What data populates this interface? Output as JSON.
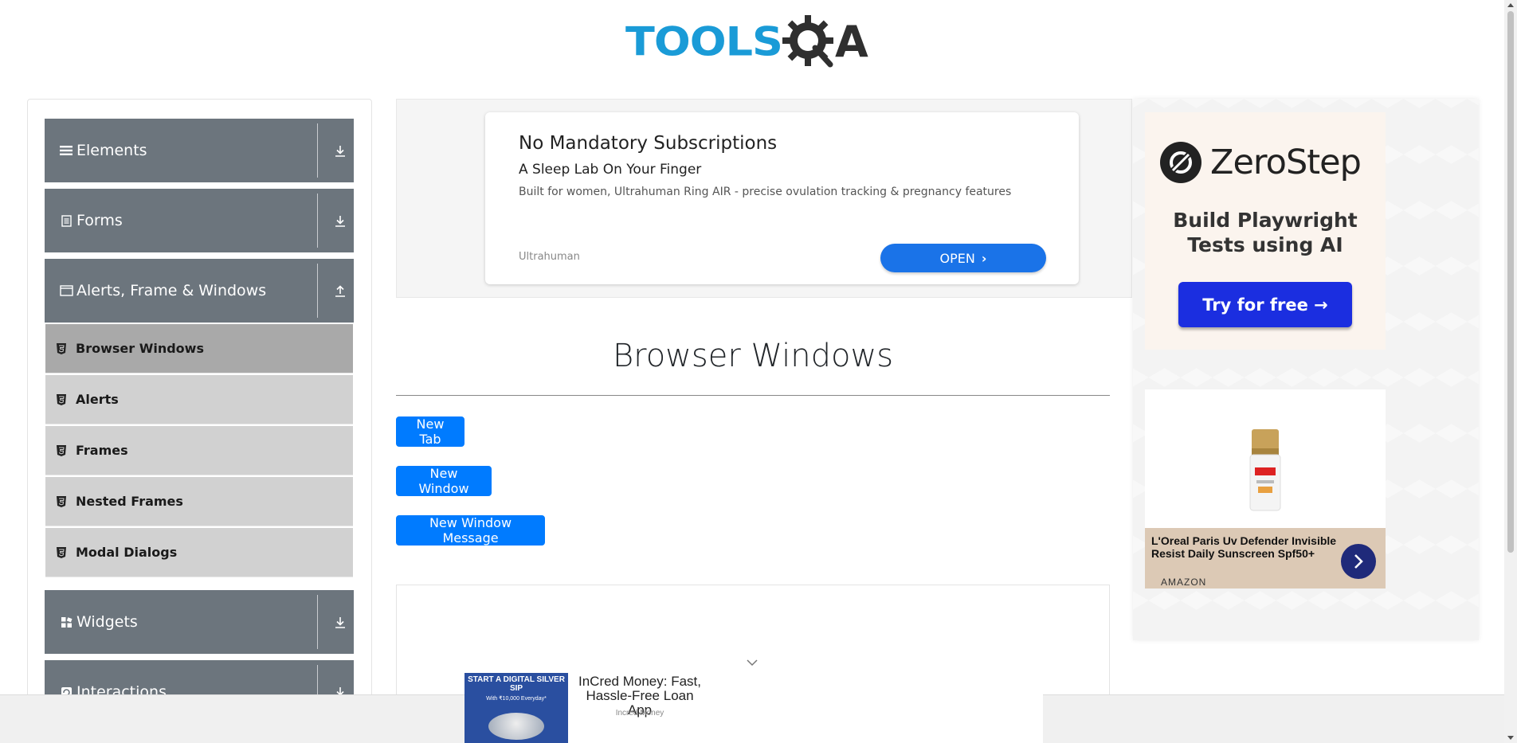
{
  "header": {
    "logo_text": "TOOLS",
    "logo_letter": "A"
  },
  "sidebar": {
    "groups": [
      {
        "label": "Elements",
        "icon": "hamburger-icon",
        "state": "collapsed"
      },
      {
        "label": "Forms",
        "icon": "document-icon",
        "state": "collapsed"
      },
      {
        "label": "Alerts, Frame & Windows",
        "icon": "window-icon",
        "state": "expanded"
      },
      {
        "label": "Widgets",
        "icon": "grid-icon",
        "state": "collapsed"
      },
      {
        "label": "Interactions",
        "icon": "refresh-icon",
        "state": "collapsed"
      }
    ],
    "sub_items": [
      {
        "label": "Browser Windows",
        "active": true
      },
      {
        "label": "Alerts",
        "active": false
      },
      {
        "label": "Frames",
        "active": false
      },
      {
        "label": "Nested Frames",
        "active": false
      },
      {
        "label": "Modal Dialogs",
        "active": false
      }
    ]
  },
  "top_ad": {
    "title": "No Mandatory Subscriptions",
    "subtitle": "A Sleep Lab On Your Finger",
    "description": "Built for women, Ultrahuman Ring AIR - precise ovulation tracking & pregnancy features",
    "brand": "Ultrahuman",
    "button_label": "OPEN",
    "button_chevron": "›"
  },
  "main": {
    "title": "Browser Windows",
    "buttons": {
      "new_tab": "New Tab",
      "new_window": "New Window",
      "new_window_message": "New Window Message"
    }
  },
  "right_ads": {
    "zerostep": {
      "name": "ZeroStep",
      "headline": "Build Playwright Tests using AI",
      "button_label": "Try for free →"
    },
    "loreal": {
      "title": "L'Oreal Paris Uv Defender Invisible Resist Daily Sunscreen Spf50+",
      "source": "AMAZON"
    }
  },
  "bottom_ad": {
    "image_text": "START A DIGITAL SILVER SIP",
    "image_subtext": "With ₹10,000 Everyday*",
    "title": "InCred Money: Fast, Hassle-Free Loan App",
    "brand": "Incred Money"
  },
  "colors": {
    "accent": "#007bff",
    "sidebar_header": "#6c757d",
    "sub_item": "#d1d1d1",
    "sub_item_active": "#a9a9a9",
    "logo_blue": "#1a9bd7"
  }
}
